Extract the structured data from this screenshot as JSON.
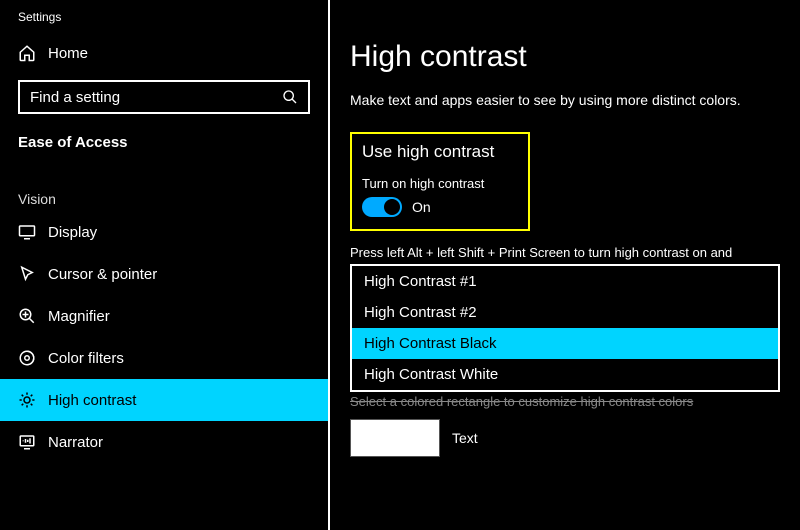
{
  "app_title": "Settings",
  "home_label": "Home",
  "search": {
    "placeholder": "Find a setting"
  },
  "category_title": "Ease of Access",
  "subcategory": "Vision",
  "nav": {
    "display": "Display",
    "cursor": "Cursor & pointer",
    "magnifier": "Magnifier",
    "color_filters": "Color filters",
    "high_contrast": "High contrast",
    "narrator": "Narrator"
  },
  "main": {
    "heading": "High contrast",
    "subtext": "Make text and apps easier to see by using more distinct colors.",
    "section_title": "Use high contrast",
    "toggle_label": "Turn on high contrast",
    "toggle_state": "On",
    "hint": "Press left Alt + left Shift + Print Screen to turn high contrast on and",
    "themes": {
      "opt1": "High Contrast #1",
      "opt2": "High Contrast #2",
      "opt3": "High Contrast Black",
      "opt4": "High Contrast White"
    },
    "caption": "Select a colored rectangle to customize high contrast colors",
    "sample_label": "Text"
  }
}
